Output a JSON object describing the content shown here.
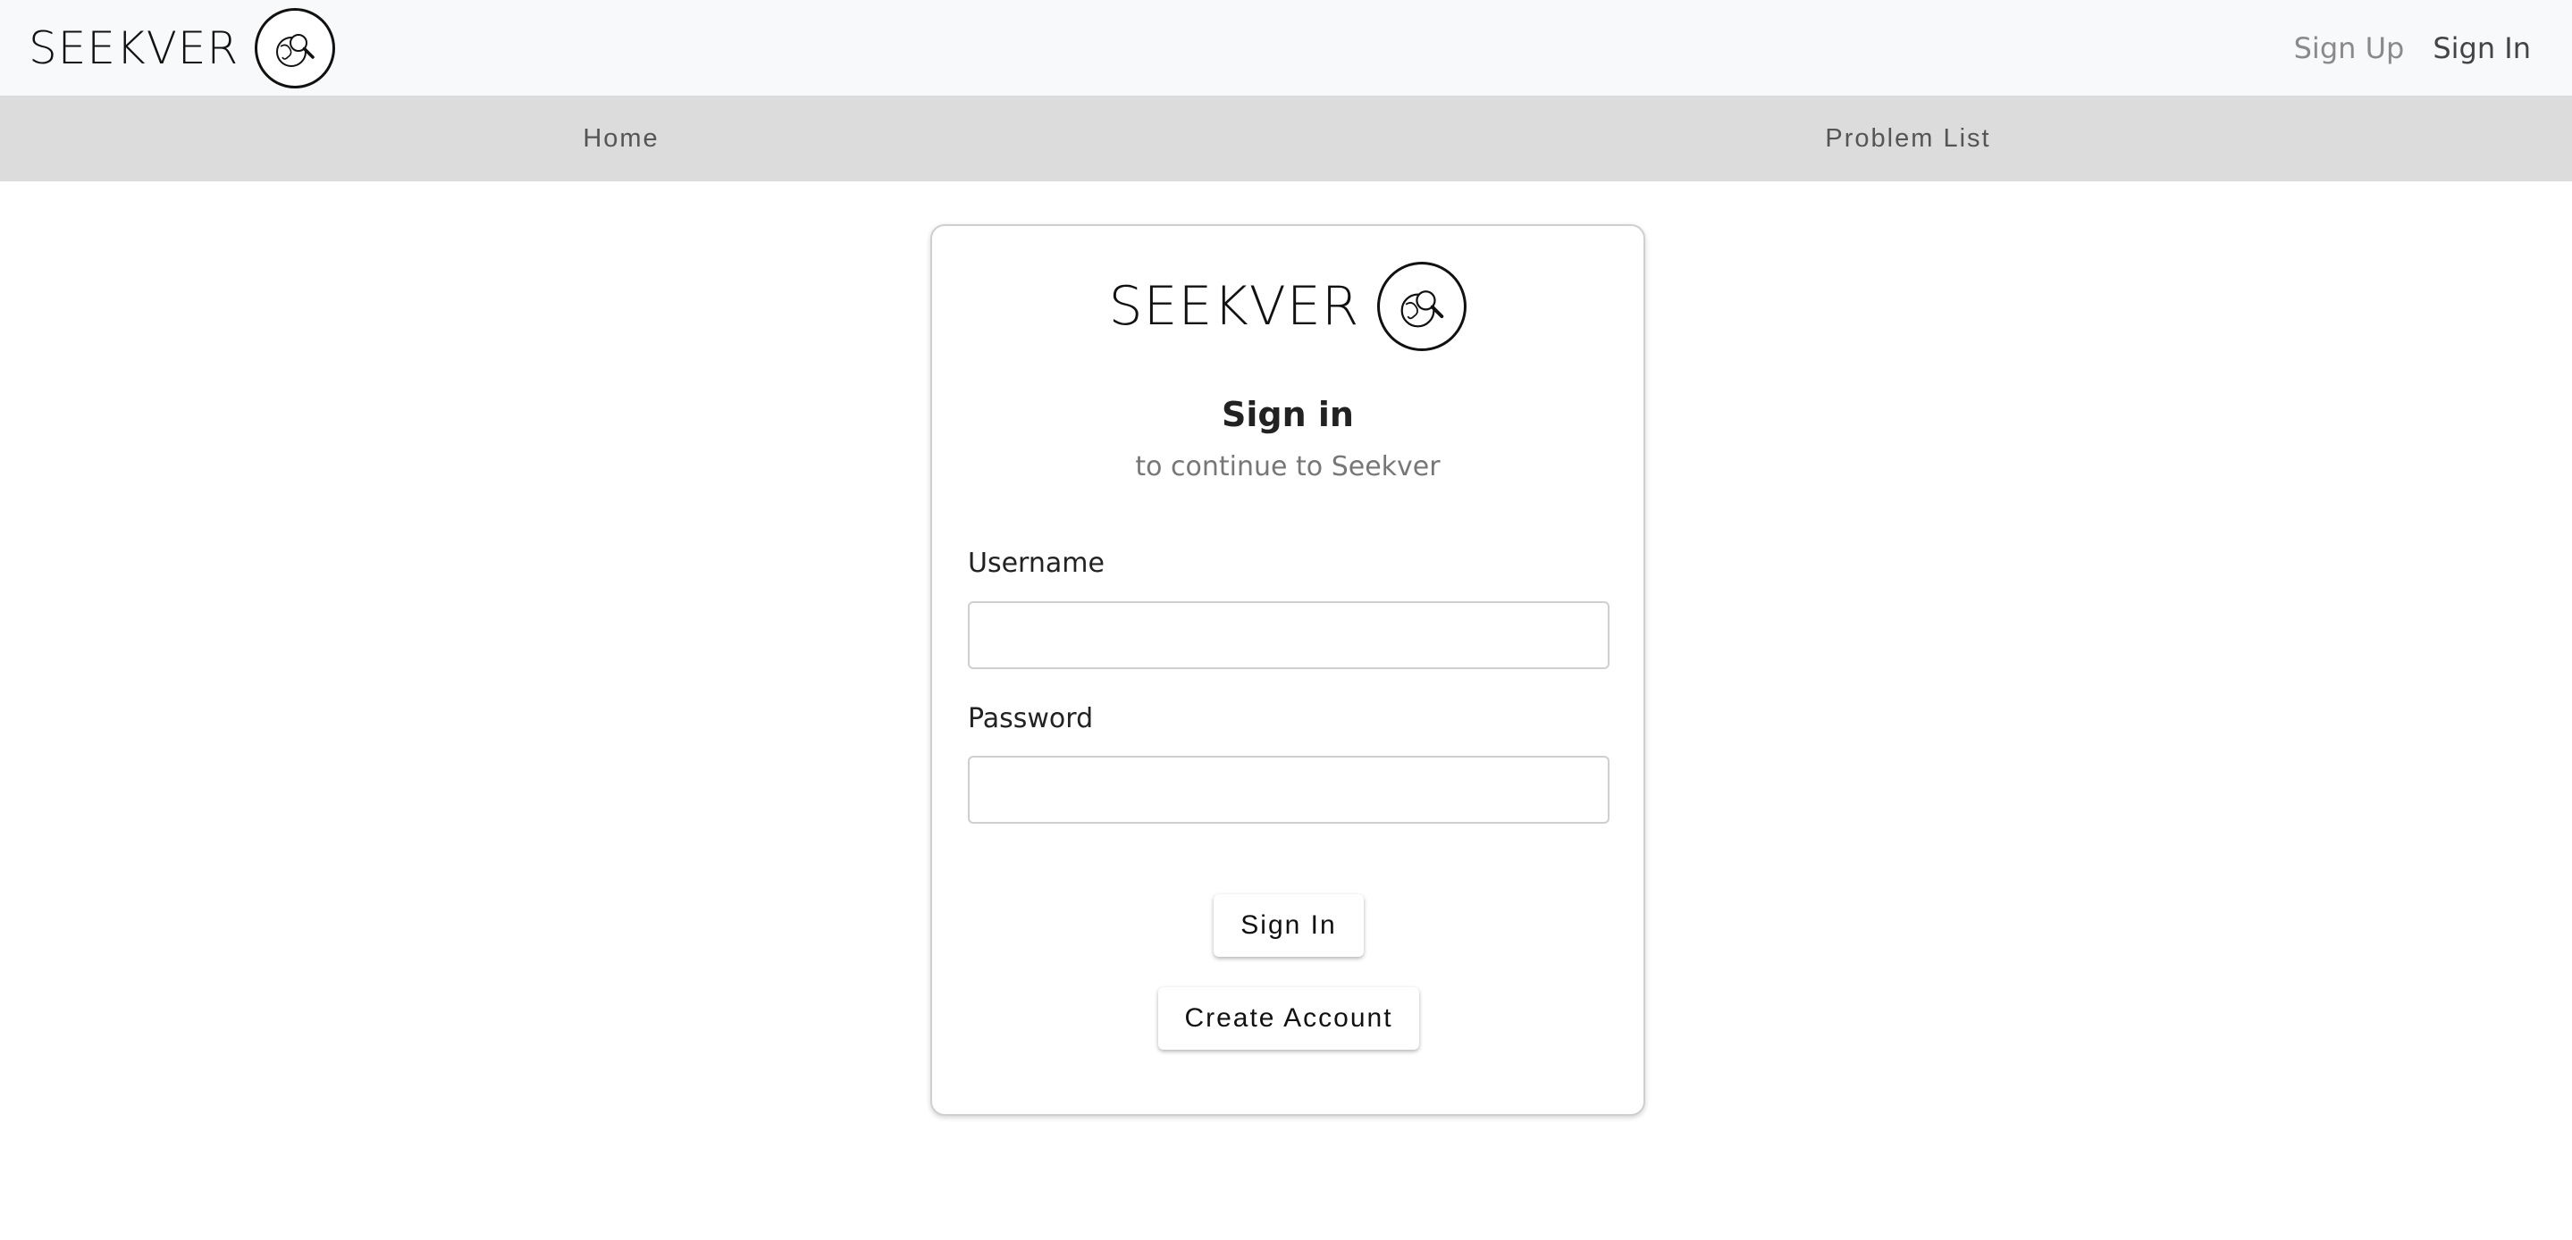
{
  "topbar": {
    "brand": "SEEKVER",
    "logo_icon": "globe-magnifier-icon",
    "links": [
      {
        "label": "Sign Up"
      },
      {
        "label": "Sign In"
      }
    ]
  },
  "nav": {
    "items": [
      {
        "label": "Home"
      },
      {
        "label": "Problem List"
      }
    ]
  },
  "card": {
    "brand": "SEEKVER",
    "title": "Sign in",
    "subtitle": "to continue to Seekver",
    "username_label": "Username",
    "username_value": "",
    "password_label": "Password",
    "password_value": "",
    "signin_button": "Sign In",
    "create_button": "Create Account"
  }
}
